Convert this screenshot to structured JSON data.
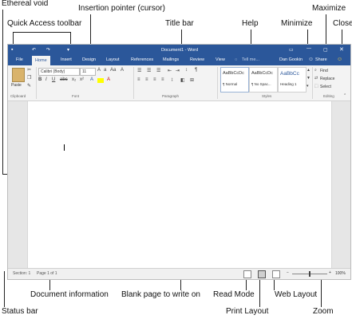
{
  "callouts": {
    "ethereal_void": "Ethereal void",
    "quick_access": "Quick Access toolbar",
    "insertion_pointer": "Insertion pointer (cursor)",
    "title_bar": "Title bar",
    "help": "Help",
    "minimize": "Minimize",
    "maximize": "Maximize",
    "close": "Close",
    "document_information": "Document information",
    "blank_page": "Blank page to write on",
    "read_mode": "Read Mode",
    "status_bar": "Status bar",
    "print_layout": "Print Layout",
    "web_layout": "Web Layout",
    "zoom": "Zoom"
  },
  "window": {
    "title": "Document1 - Word",
    "user": "Dan Gookin",
    "share": "Share",
    "tell_me": "Tell me...",
    "tabs": [
      "File",
      "Home",
      "Insert",
      "Design",
      "Layout",
      "References",
      "Mailings",
      "Review",
      "View"
    ],
    "active_tab": "Home"
  },
  "ribbon": {
    "paste": "Paste",
    "font_name": "Calibri (Body)",
    "font_size": "11",
    "groups": {
      "clipboard": "Clipboard",
      "font": "Font",
      "paragraph": "Paragraph",
      "styles": "Styles",
      "editing": "Editing"
    },
    "styles": [
      {
        "sample": "AaBbCcDc",
        "name": "¶ Normal"
      },
      {
        "sample": "AaBbCcDc",
        "name": "¶ No Spac..."
      },
      {
        "sample": "AaBbCc",
        "name": "Heading 1"
      }
    ],
    "editing": {
      "find": "Find",
      "replace": "Replace",
      "select": "Select"
    }
  },
  "statusbar": {
    "section": "Section: 1",
    "page": "Page 1 of 1",
    "zoom": "100%"
  },
  "colors": {
    "word_blue": "#2b579a",
    "ribbon_bg": "#f3f3f3",
    "highlight": "#ffff00",
    "font_red": "#c00000"
  }
}
